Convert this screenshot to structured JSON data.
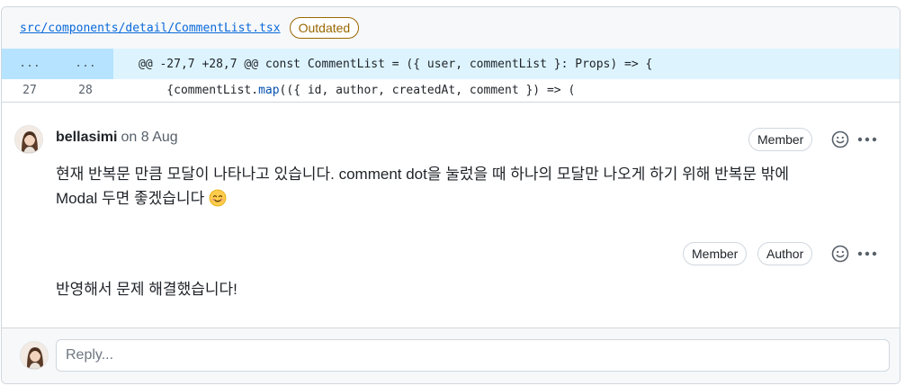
{
  "file": {
    "path": "src/components/detail/CommentList.tsx",
    "status_badge": "Outdated"
  },
  "diff": {
    "hunk_old": "...",
    "hunk_new": "...",
    "hunk_header": "@@ -27,7 +28,7 @@ const CommentList = ({ user, commentList }: Props) => {",
    "line_old": "27",
    "line_new": "28",
    "code_prefix": "    {commentList.",
    "code_fn": "map",
    "code_suffix": "(({ id, author, createdAt, comment }) => ("
  },
  "comments": [
    {
      "author": "bellasimi",
      "date": "on 8 Aug",
      "badges": [
        "Member"
      ],
      "body_line1": "현재 반복문 만큼 모달이 나타나고 있습니다. comment dot을 눌렀을 때 하나의 모달만 나오게 하기 위해 반복문 밖에",
      "body_line2": "Modal 두면 좋겠습니다"
    },
    {
      "badges": [
        "Member",
        "Author"
      ],
      "body": "반영해서 문제 해결했습니다!"
    }
  ],
  "reply": {
    "placeholder": "Reply..."
  },
  "icons": {
    "reaction": "smiley-icon",
    "more": "kebab-horizontal-icon",
    "emoji": "smiling-face-emoji"
  },
  "colors": {
    "link": "#0969da",
    "outdated": "#9a6700",
    "hunk_bg": "#ddf4ff",
    "hunk_num_bg": "#b6e3ff"
  }
}
